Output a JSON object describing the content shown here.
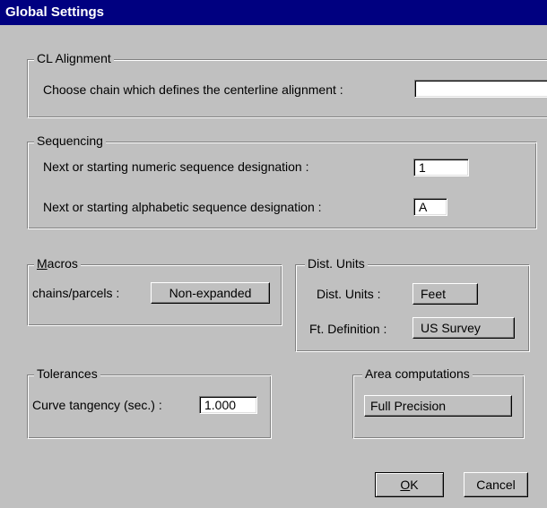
{
  "window": {
    "title": "Global Settings"
  },
  "cl_alignment": {
    "legend": "CL Alignment",
    "label": "Choose chain which defines the centerline alignment :",
    "value": ""
  },
  "sequencing": {
    "legend": "Sequencing",
    "numeric_label": "Next or starting numeric sequence designation :",
    "numeric_value": "1",
    "alpha_label": "Next or starting alphabetic sequence designation :",
    "alpha_value": "A"
  },
  "macros": {
    "legend_mnemonic": "M",
    "legend_rest": "acros",
    "label": "chains/parcels :",
    "button": "Non-expanded"
  },
  "dist_units": {
    "legend": "Dist. Units",
    "units_label": "Dist. Units :",
    "units_button": "Feet",
    "ft_label": "Ft. Definition :",
    "ft_button": "US Survey"
  },
  "tolerances": {
    "legend": "Tolerances",
    "label": "Curve tangency (sec.) :",
    "value": "1.000"
  },
  "area": {
    "legend": "Area computations",
    "button": "Full Precision"
  },
  "footer": {
    "ok_mnemonic": "O",
    "ok_rest": "K",
    "cancel": "Cancel"
  }
}
